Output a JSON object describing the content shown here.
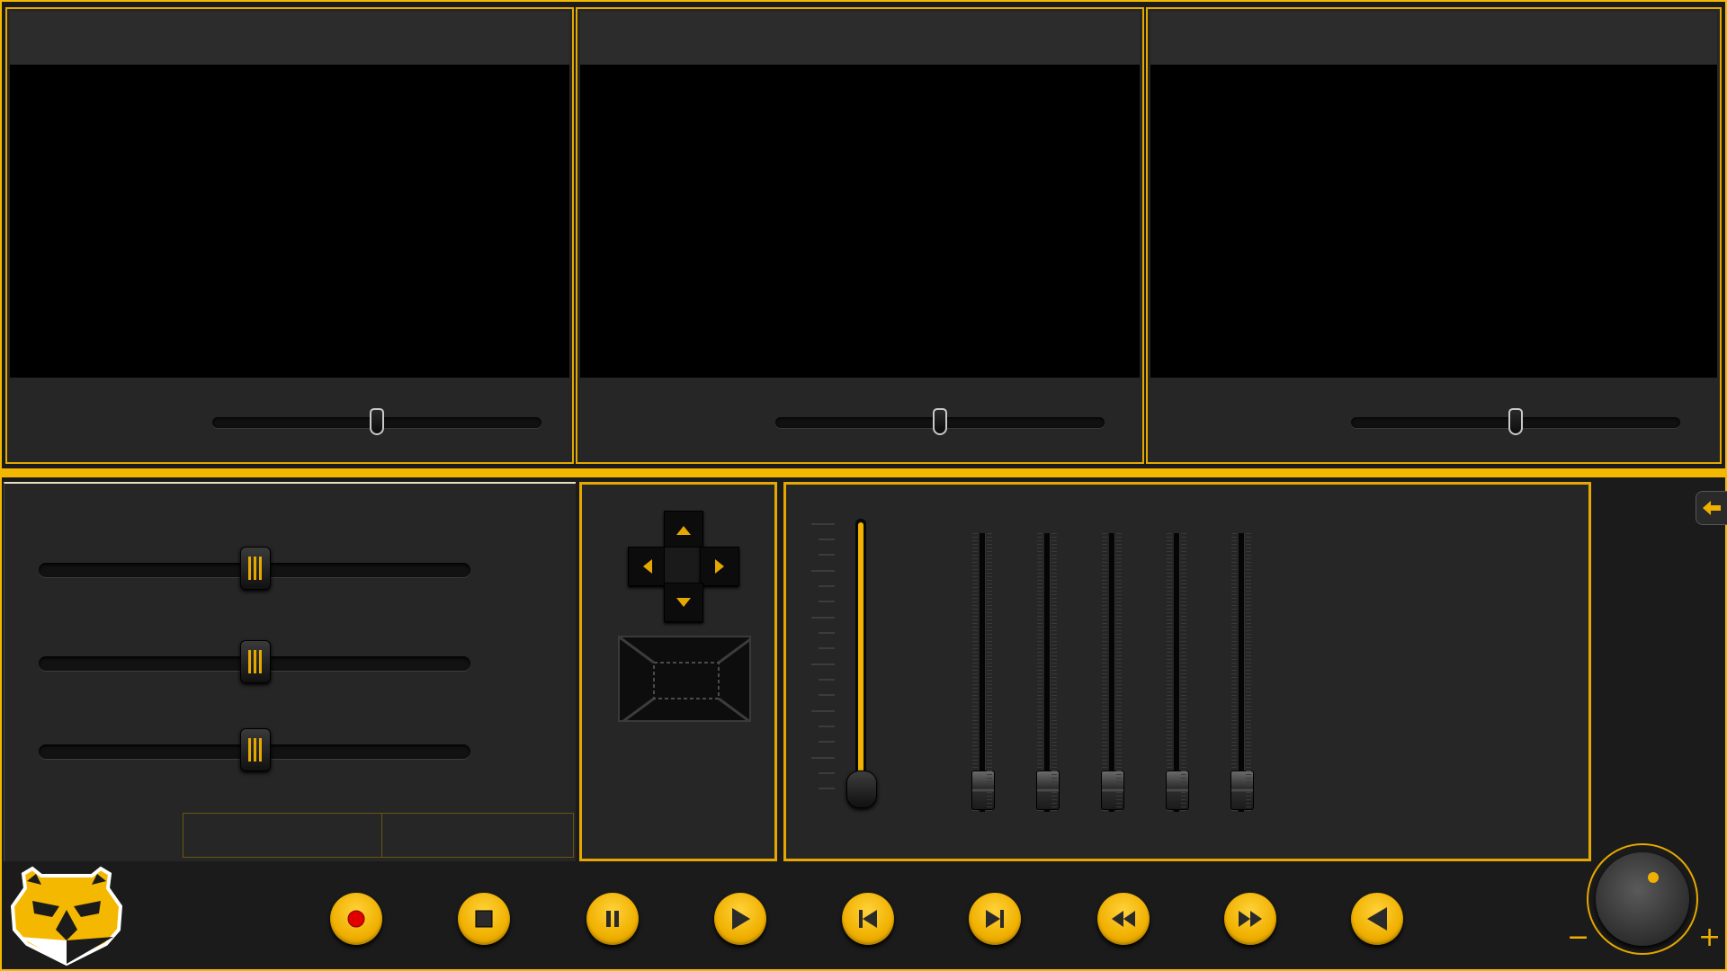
{
  "app": {
    "accent_color": "#f5b800",
    "panel_color": "#262626",
    "screen_color": "#000000"
  },
  "video_panels": [
    {
      "name": "video-1",
      "seek_position": 0.5
    },
    {
      "name": "video-2",
      "seek_position": 0.5
    },
    {
      "name": "video-3",
      "seek_position": 0.5
    }
  ],
  "image_sliders": [
    {
      "name": "slider-1",
      "value": 0.5
    },
    {
      "name": "slider-2",
      "value": 0.5
    },
    {
      "name": "slider-3",
      "value": 0.5
    }
  ],
  "tabs": [
    "",
    ""
  ],
  "ptz": {
    "up_icon": "arrow-up-icon",
    "down_icon": "arrow-down-icon",
    "left_icon": "arrow-left-icon",
    "right_icon": "arrow-right-icon",
    "zoom_icon": "zoom-frame-icon"
  },
  "mixer": {
    "master_level": 0.97,
    "channels": [
      0.0,
      0.0,
      0.0,
      0.0,
      0.0
    ]
  },
  "transport": [
    {
      "name": "record-button",
      "icon": "record-icon"
    },
    {
      "name": "stop-button",
      "icon": "stop-icon"
    },
    {
      "name": "pause-button",
      "icon": "pause-icon"
    },
    {
      "name": "play-button",
      "icon": "play-icon"
    },
    {
      "name": "previous-button",
      "icon": "skip-back-icon"
    },
    {
      "name": "next-button",
      "icon": "skip-forward-icon"
    },
    {
      "name": "rewind-button",
      "icon": "rewind-icon"
    },
    {
      "name": "fast-forward-button",
      "icon": "fast-forward-icon"
    },
    {
      "name": "back-button",
      "icon": "triangle-left-icon"
    }
  ],
  "volume": {
    "minus_label": "−",
    "plus_label": "+",
    "level": 0.5
  }
}
